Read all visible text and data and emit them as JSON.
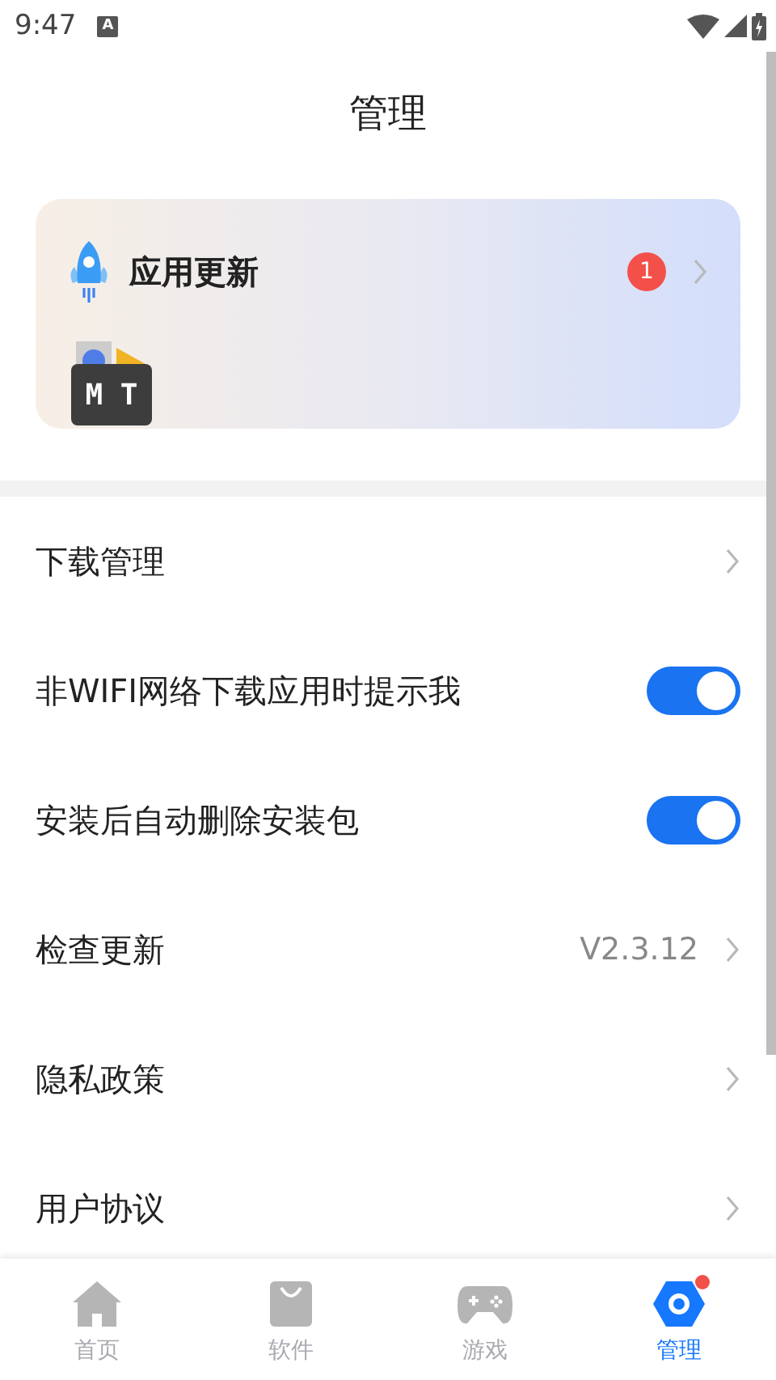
{
  "status_bar": {
    "time": "9:47",
    "notification": "A"
  },
  "header": {
    "title": "管理"
  },
  "update_card": {
    "title": "应用更新",
    "badge": "1",
    "apps": [
      {
        "label": "M T"
      }
    ]
  },
  "settings": [
    {
      "kind": "link",
      "label": "下载管理"
    },
    {
      "kind": "toggle",
      "label": "非WIFI网络下载应用时提示我",
      "on": true
    },
    {
      "kind": "toggle",
      "label": "安装后自动删除安装包",
      "on": true
    },
    {
      "kind": "value",
      "label": "检查更新",
      "value": "V2.3.12"
    },
    {
      "kind": "link",
      "label": "隐私政策"
    },
    {
      "kind": "link",
      "label": "用户协议"
    }
  ],
  "bottom_nav": [
    {
      "kind": "home",
      "label": "首页",
      "selected": false,
      "dot": false
    },
    {
      "kind": "bag",
      "label": "软件",
      "selected": false,
      "dot": false
    },
    {
      "kind": "game",
      "label": "游戏",
      "selected": false,
      "dot": false
    },
    {
      "kind": "manage",
      "label": "管理",
      "selected": true,
      "dot": true
    }
  ]
}
